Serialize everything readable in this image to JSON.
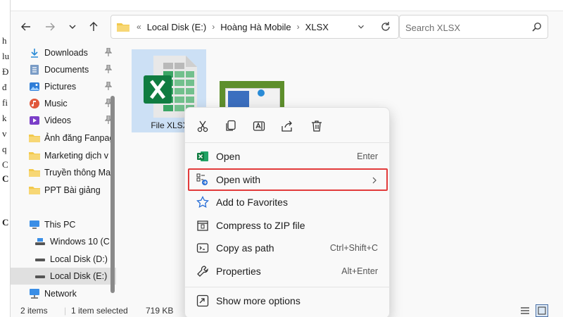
{
  "bg_doc": [
    "h",
    "lu",
    "Đ",
    "đ",
    "fi",
    "k",
    "v",
    "q",
    "C",
    "C",
    "C"
  ],
  "address": {
    "prefix": "«",
    "segments": [
      "Local Disk (E:)",
      "Hoàng Hà Mobile",
      "XLSX"
    ]
  },
  "search": {
    "placeholder": "Search XLSX"
  },
  "sidebar": {
    "items": [
      {
        "label": "Downloads",
        "icon": "download-icon",
        "pinned": true
      },
      {
        "label": "Documents",
        "icon": "documents-icon",
        "pinned": true
      },
      {
        "label": "Pictures",
        "icon": "pictures-icon",
        "pinned": true
      },
      {
        "label": "Music",
        "icon": "music-icon",
        "pinned": true
      },
      {
        "label": "Videos",
        "icon": "videos-icon",
        "pinned": true
      },
      {
        "label": "Ảnh đăng Fanpag",
        "icon": "folder-icon"
      },
      {
        "label": "Marketing dịch v",
        "icon": "folder-icon"
      },
      {
        "label": "Truyền thông Ma",
        "icon": "folder-icon"
      },
      {
        "label": "PPT Bài giảng",
        "icon": "folder-icon"
      },
      {
        "label": "This PC",
        "icon": "pc-icon"
      },
      {
        "label": "Windows 10 (C",
        "icon": "drive-icon"
      },
      {
        "label": "Local Disk (D:)",
        "icon": "drive-icon"
      },
      {
        "label": "Local Disk (E:)",
        "icon": "drive-icon",
        "selected": true
      },
      {
        "label": "Network",
        "icon": "network-icon"
      }
    ]
  },
  "files": [
    {
      "label": "File XLSX",
      "icon": "excel-file-icon",
      "selected": true
    },
    {
      "label": "",
      "icon": "image-thumbnail"
    }
  ],
  "status": {
    "items": "2 items",
    "selected": "1 item selected",
    "size": "719 KB"
  },
  "context_menu": {
    "quick_actions": [
      "cut-icon",
      "copy-icon",
      "rename-icon",
      "share-icon",
      "delete-icon"
    ],
    "items": [
      {
        "label": "Open",
        "shortcut": "Enter",
        "icon": "excel-icon"
      },
      {
        "label": "Open with",
        "shortcut": "",
        "icon": "open-with-icon",
        "highlighted": true,
        "submenu": true
      },
      {
        "label": "Add to Favorites",
        "shortcut": "",
        "icon": "star-icon"
      },
      {
        "label": "Compress to ZIP file",
        "shortcut": "",
        "icon": "zip-icon"
      },
      {
        "label": "Copy as path",
        "shortcut": "Ctrl+Shift+C",
        "icon": "copy-path-icon"
      },
      {
        "label": "Properties",
        "shortcut": "Alt+Enter",
        "icon": "wrench-icon"
      },
      {
        "label": "Show more options",
        "shortcut": "",
        "icon": "more-options-icon"
      }
    ]
  },
  "colors": {
    "accent": "#0067c0",
    "selection": "#cce0f5",
    "highlight_border": "#e23b3b",
    "excel_green": "#107c41"
  }
}
